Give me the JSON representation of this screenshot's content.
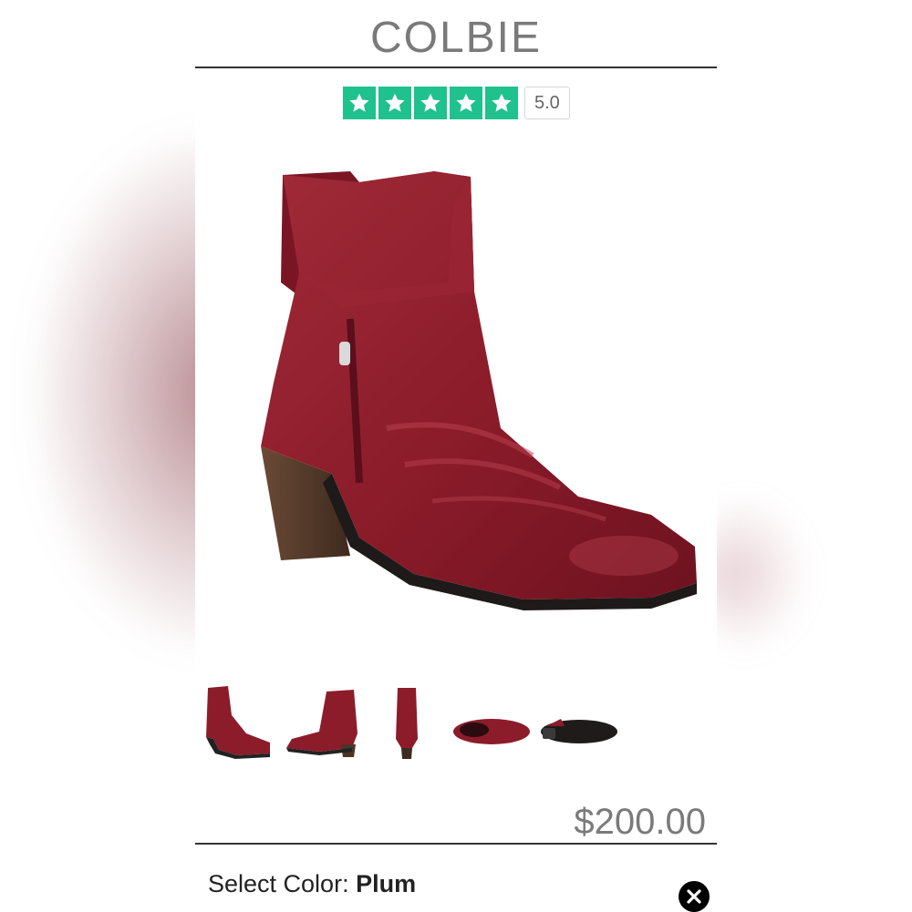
{
  "product": {
    "name": "COLBIE",
    "rating": {
      "value": "5.0",
      "stars": 5,
      "star_color": "#1fc18d"
    },
    "price": "$200.00",
    "color": {
      "label": "Select Color: ",
      "value": "Plum"
    },
    "images": {
      "main": "boot-side-view",
      "thumbnails": [
        "boot-side-view",
        "boot-outer-view",
        "boot-back-view",
        "boot-top-view",
        "boot-sole-view"
      ]
    }
  },
  "colors": {
    "boot": "#8c1c2a",
    "rating_green": "#1fc18d",
    "text_grey": "#7a7a7a"
  },
  "icons": {
    "close": "close-circle-icon",
    "star": "star-icon"
  }
}
